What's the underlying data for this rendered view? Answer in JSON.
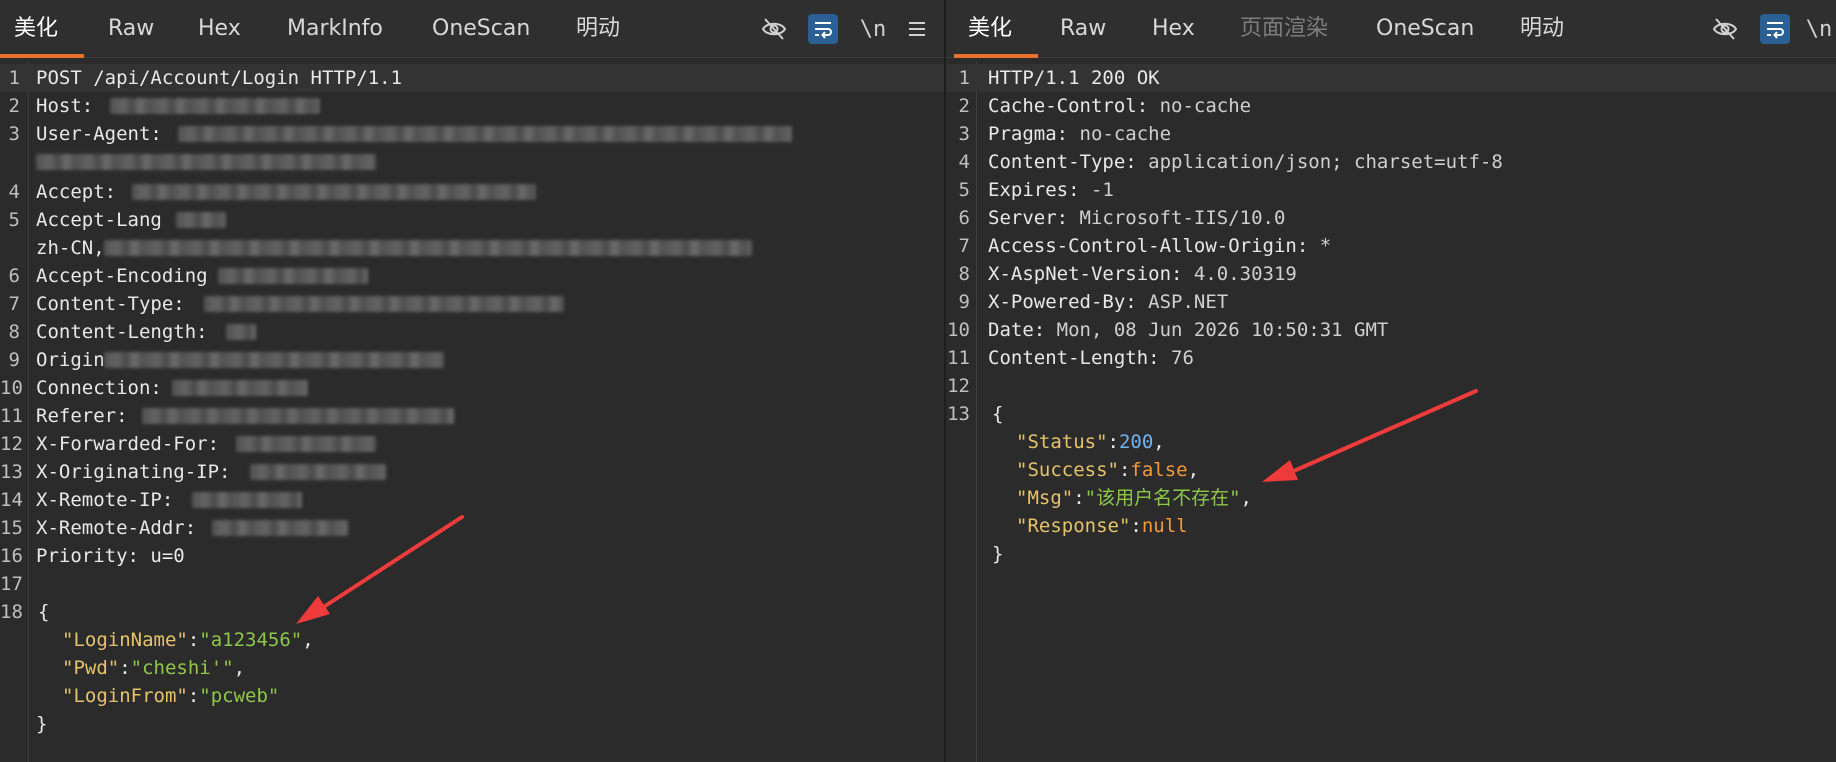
{
  "left_pane": {
    "tabs": [
      "美化",
      "Raw",
      "Hex",
      "MarkInfo",
      "OneScan",
      "明动"
    ],
    "toolbar": {
      "eye_icon": "eye-off-icon",
      "wrap_icon": "wrap-lines-icon",
      "newline_label": "\\n",
      "menu_icon": "hamburger-icon"
    },
    "line_numbers": [
      "1",
      "2",
      "3",
      "4",
      "5",
      "6",
      "7",
      "8",
      "9",
      "10",
      "11",
      "12",
      "13",
      "14",
      "15",
      "16",
      "17",
      "18"
    ],
    "lines": {
      "l1": "POST /api/Account/Login HTTP/1.1",
      "l2": "Host:",
      "l3": "User-Agent:",
      "l4": "Accept:",
      "l5": "Accept-Lang",
      "l5b": "zh-CN,",
      "l6": "Accept-Encoding",
      "l7": "Content-Type:",
      "l8": "Content-Length:",
      "l9": "Origin",
      "l10": "Connection:",
      "l11": "Referer:",
      "l12": "X-Forwarded-For:",
      "l13": "X-Originating-IP:",
      "l14": "X-Remote-IP:",
      "l15": "X-Remote-Addr:",
      "l16": "Priority: u=0",
      "l18": "{"
    },
    "json_body": {
      "login_name_key": "\"LoginName\"",
      "login_name_val": "\"a123456\"",
      "pwd_key": "\"Pwd\"",
      "pwd_val": "\"cheshi'\"",
      "login_from_key": "\"LoginFrom\"",
      "login_from_val": "\"pcweb\"",
      "close": "}"
    }
  },
  "right_pane": {
    "tabs": [
      "美化",
      "Raw",
      "Hex",
      "页面渲染",
      "OneScan",
      "明动"
    ],
    "toolbar": {
      "eye_icon": "eye-off-icon",
      "wrap_icon": "wrap-lines-icon",
      "newline_label": "\\n"
    },
    "line_numbers": [
      "1",
      "2",
      "3",
      "4",
      "5",
      "6",
      "7",
      "8",
      "9",
      "10",
      "11",
      "12",
      "13"
    ],
    "headers": [
      {
        "name": "HTTP/1.1 200 OK",
        "value": ""
      },
      {
        "name": "Cache-Control:",
        "value": " no-cache"
      },
      {
        "name": "Pragma:",
        "value": " no-cache"
      },
      {
        "name": "Content-Type:",
        "value": " application/json; charset=utf-8"
      },
      {
        "name": "Expires:",
        "value": " -1"
      },
      {
        "name": "Server:",
        "value": " Microsoft-IIS/10.0"
      },
      {
        "name": "Access-Control-Allow-Origin:",
        "value": " *"
      },
      {
        "name": "X-AspNet-Version:",
        "value": " 4.0.30319"
      },
      {
        "name": "X-Powered-By:",
        "value": " ASP.NET"
      },
      {
        "name": "Date:",
        "value": " Mon, 08 Jun 2026 10:50:31 GMT"
      },
      {
        "name": "Content-Length:",
        "value": " 76"
      }
    ],
    "json_body": {
      "open": "{",
      "status_key": "\"Status\"",
      "status_val": "200",
      "success_key": "\"Success\"",
      "success_val": "false",
      "msg_key": "\"Msg\"",
      "msg_val": "\"该用户名不存在\"",
      "response_key": "\"Response\"",
      "response_val": "null",
      "close": "}"
    }
  },
  "colors": {
    "background": "#2b2b2b",
    "tab_underline": "#e8702a",
    "json_key": "#e6c36a",
    "json_string": "#8fc74a",
    "json_number": "#6fb3ef",
    "json_keyword": "#f29a3a",
    "arrow": "#ef3b3b"
  }
}
